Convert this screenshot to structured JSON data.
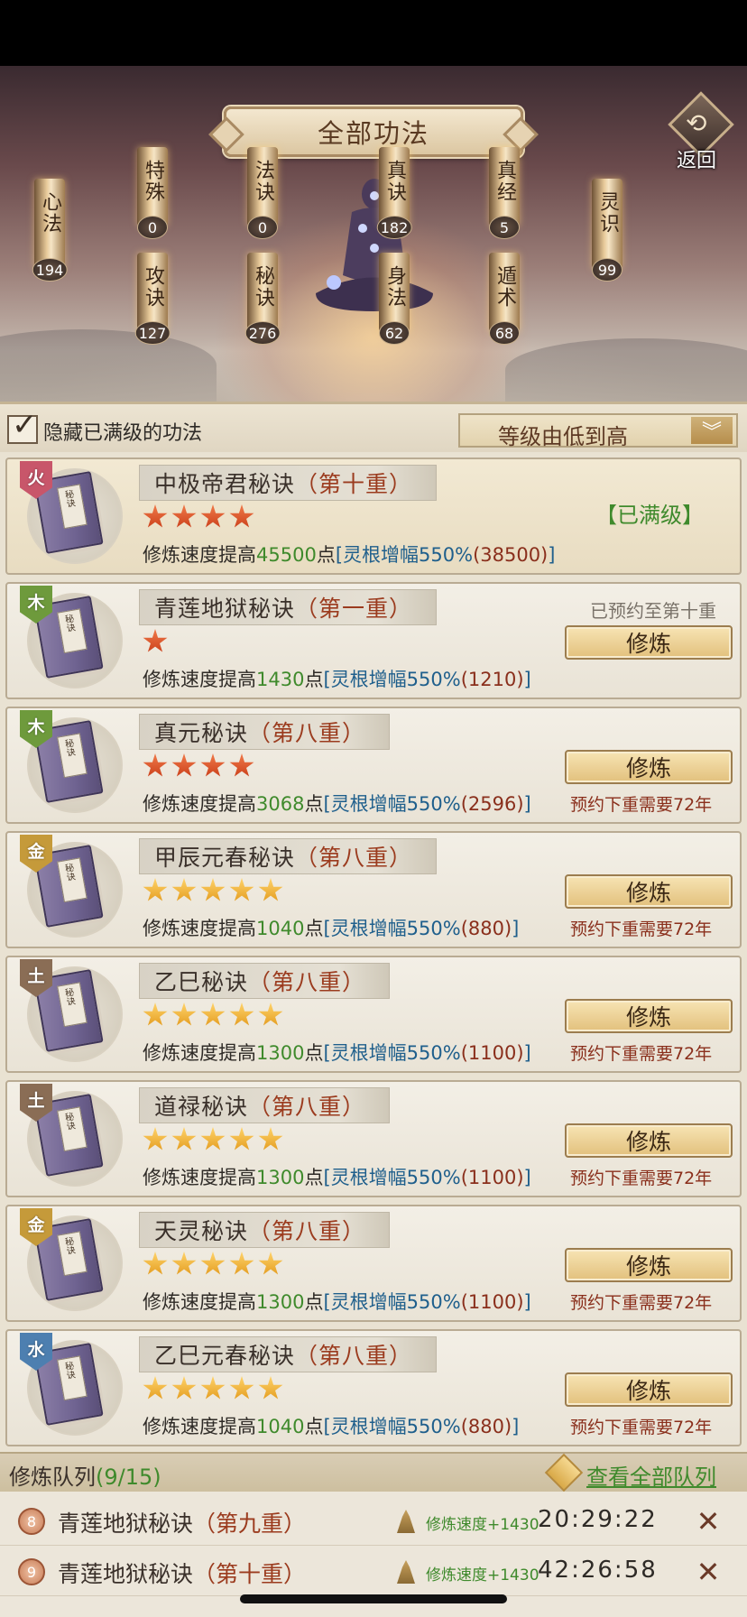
{
  "header": {
    "title": "全部功法",
    "back_label": "返回"
  },
  "categories": [
    {
      "key": "xinfa",
      "label": "心法",
      "count": "194"
    },
    {
      "key": "teshu",
      "label": "特殊",
      "count": "0"
    },
    {
      "key": "gongjue",
      "label": "攻诀",
      "count": "127"
    },
    {
      "key": "fajue",
      "label": "法诀",
      "count": "0"
    },
    {
      "key": "mijue",
      "label": "秘诀",
      "count": "276"
    },
    {
      "key": "zhenjue",
      "label": "真诀",
      "count": "182"
    },
    {
      "key": "shenfa",
      "label": "身法",
      "count": "62"
    },
    {
      "key": "zhenjing",
      "label": "真经",
      "count": "5"
    },
    {
      "key": "dunshu",
      "label": "遁术",
      "count": "68"
    },
    {
      "key": "lingshi",
      "label": "灵识",
      "count": "99"
    }
  ],
  "filter": {
    "hide_maxed_label": "隐藏已满级的功法",
    "hide_maxed_checked": true,
    "sort_label": "等级由低到高"
  },
  "element_colors": {
    "火": "#c8566a",
    "木": "#6e9a3c",
    "金": "#c59a3a",
    "土": "#8a6d55",
    "水": "#4d7fb0"
  },
  "stat_text": {
    "prefix": "修炼速度提高",
    "unit": "点",
    "bracket_open": "[灵根增幅",
    "bracket_close": "]"
  },
  "skills": [
    {
      "element": "火",
      "name": "中极帝君秘诀",
      "level": "（第十重）",
      "stars": 4,
      "star_color": "red",
      "speed": "45500",
      "boost": "550%",
      "base": "(38500)",
      "status": "maxed",
      "status_text": "【已满级】"
    },
    {
      "element": "木",
      "name": "青莲地狱秘诀",
      "level": "（第一重）",
      "stars": 1,
      "star_color": "red",
      "speed": "1430",
      "boost": "550%",
      "base": "(1210)",
      "status": "reserved",
      "reserved_text": "已预约至第十重",
      "button": "修炼"
    },
    {
      "element": "木",
      "name": "真元秘诀",
      "level": "（第八重）",
      "stars": 4,
      "star_color": "red",
      "speed": "3068",
      "boost": "550%",
      "base": "(2596)",
      "status": "train",
      "button": "修炼",
      "next_req": "预约下重需要72年"
    },
    {
      "element": "金",
      "name": "甲辰元春秘诀",
      "level": "（第八重）",
      "stars": 5,
      "star_color": "gold",
      "speed": "1040",
      "boost": "550%",
      "base": "(880)",
      "status": "train",
      "button": "修炼",
      "next_req": "预约下重需要72年"
    },
    {
      "element": "土",
      "name": "乙巳秘诀",
      "level": "（第八重）",
      "stars": 5,
      "star_color": "gold",
      "speed": "1300",
      "boost": "550%",
      "base": "(1100)",
      "status": "train",
      "button": "修炼",
      "next_req": "预约下重需要72年"
    },
    {
      "element": "土",
      "name": "道禄秘诀",
      "level": "（第八重）",
      "stars": 5,
      "star_color": "gold",
      "speed": "1300",
      "boost": "550%",
      "base": "(1100)",
      "status": "train",
      "button": "修炼",
      "next_req": "预约下重需要72年"
    },
    {
      "element": "金",
      "name": "天灵秘诀",
      "level": "（第八重）",
      "stars": 5,
      "star_color": "gold",
      "speed": "1300",
      "boost": "550%",
      "base": "(1100)",
      "status": "train",
      "button": "修炼",
      "next_req": "预约下重需要72年"
    },
    {
      "element": "水",
      "name": "乙巳元春秘诀",
      "level": "（第八重）",
      "stars": 5,
      "star_color": "gold",
      "speed": "1040",
      "boost": "550%",
      "base": "(880)",
      "status": "train",
      "button": "修炼",
      "next_req": "预约下重需要72年"
    }
  ],
  "book_tag": "秘诀",
  "queue": {
    "title": "修炼队列",
    "count": "(9/15)",
    "view_all": "查看全部队列",
    "items": [
      {
        "num": "8",
        "name": "青莲地狱秘诀",
        "level": "（第九重）",
        "speed": "修炼速度+1430",
        "time": "20:29:22"
      },
      {
        "num": "9",
        "name": "青莲地狱秘诀",
        "level": "（第十重）",
        "speed": "修炼速度+1430",
        "time": "42:26:58"
      }
    ]
  }
}
